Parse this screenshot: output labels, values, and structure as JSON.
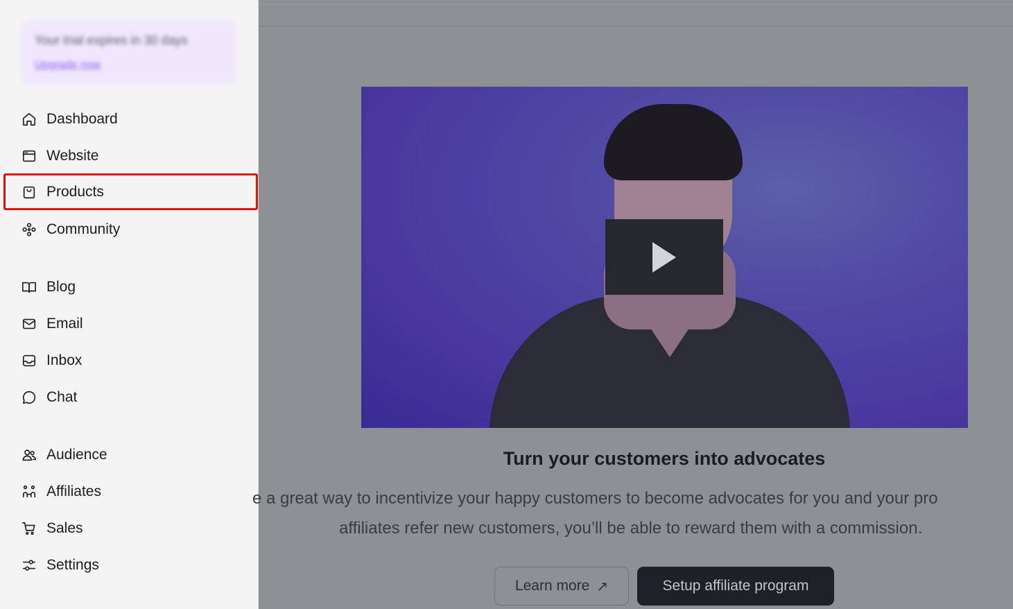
{
  "sidebar": {
    "trial": {
      "text": "Your trial expires in 30 days",
      "link": "Upgrade now"
    },
    "items": [
      {
        "label": "Dashboard",
        "icon": "home-icon"
      },
      {
        "label": "Website",
        "icon": "browser-window-icon"
      },
      {
        "label": "Products",
        "icon": "shopping-bag-icon"
      },
      {
        "label": "Community",
        "icon": "community-nodes-icon"
      },
      {
        "label": "Blog",
        "icon": "open-book-icon"
      },
      {
        "label": "Email",
        "icon": "envelope-icon"
      },
      {
        "label": "Inbox",
        "icon": "inbox-tray-icon"
      },
      {
        "label": "Chat",
        "icon": "speech-bubble-icon"
      },
      {
        "label": "Audience",
        "icon": "users-icon"
      },
      {
        "label": "Affiliates",
        "icon": "affiliate-network-icon"
      },
      {
        "label": "Sales",
        "icon": "shopping-cart-icon"
      },
      {
        "label": "Settings",
        "icon": "sliders-icon"
      }
    ],
    "highlight_color": "#e0120f"
  },
  "main": {
    "headline": "Turn your customers into advocates",
    "description_line1": "e a great way to incentivize your happy customers to become advocates for you and your pro",
    "description_line2": "affiliates refer new customers, you’ll be able to reward them with a commission.",
    "learn_more_label": "Learn more",
    "learn_more_icon": "arrow-up-right-icon",
    "setup_label": "Setup affiliate program",
    "video_play_icon": "play-icon"
  }
}
